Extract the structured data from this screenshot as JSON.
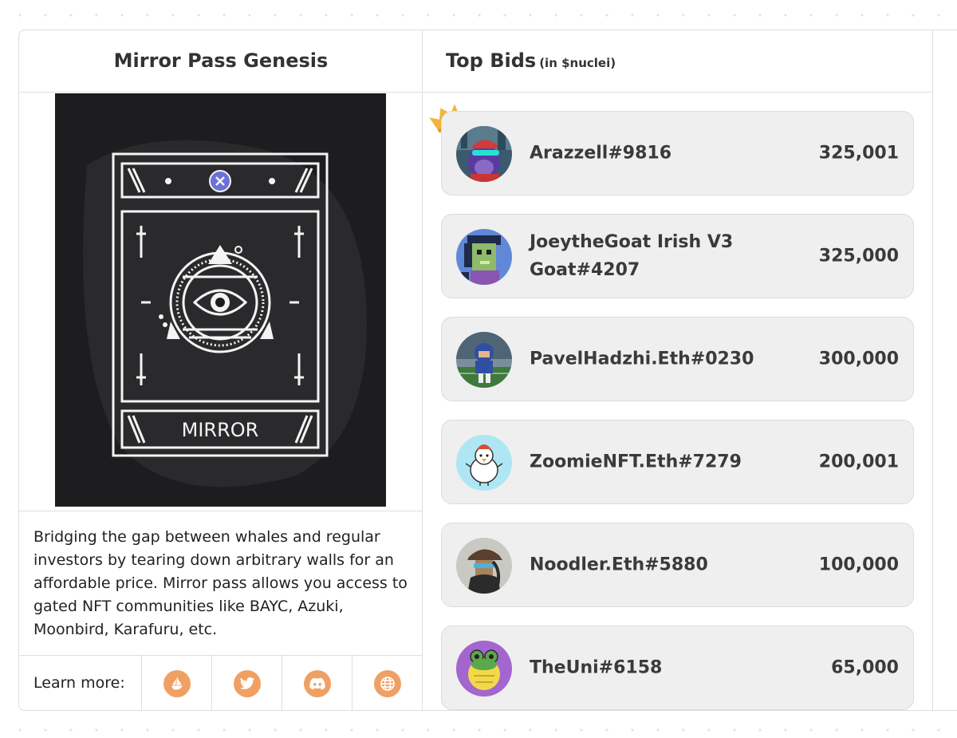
{
  "pass": {
    "title": "Mirror Pass Genesis",
    "card_label": "MIRROR",
    "description": "Bridging the gap between whales and regular investors by tearing down arbitrary walls for an affordable price. Mirror pass allows you access to gated NFT communities like BAYC, Azuki, Moonbird, Karafuru, etc.",
    "learn_more_label": "Learn more:",
    "links": [
      {
        "icon": "opensea-icon"
      },
      {
        "icon": "twitter-icon"
      },
      {
        "icon": "discord-icon"
      },
      {
        "icon": "globe-icon"
      }
    ]
  },
  "bids": {
    "title": "Top Bids",
    "unit": "(in $nuclei)",
    "items": [
      {
        "name": "Arazzell#9816",
        "amount": "325,001",
        "avatar": "ape-avatar"
      },
      {
        "name": "JoeytheGoat Irish V3 Goat#4207",
        "amount": "325,000",
        "avatar": "pixel-goat-avatar"
      },
      {
        "name": "PavelHadzhi.Eth#0230",
        "amount": "300,000",
        "avatar": "football-player-avatar"
      },
      {
        "name": "ZoomieNFT.Eth#7279",
        "amount": "200,001",
        "avatar": "bird-avatar"
      },
      {
        "name": "Noodler.Eth#5880",
        "amount": "100,000",
        "avatar": "capped-character-avatar"
      },
      {
        "name": "TheUni#6158",
        "amount": "65,000",
        "avatar": "frog-avatar"
      }
    ]
  },
  "colors": {
    "accent": "#f0a063",
    "card_bg": "#1d1d1f",
    "bid_bg": "#efefef",
    "crown": "#f2b43c"
  }
}
